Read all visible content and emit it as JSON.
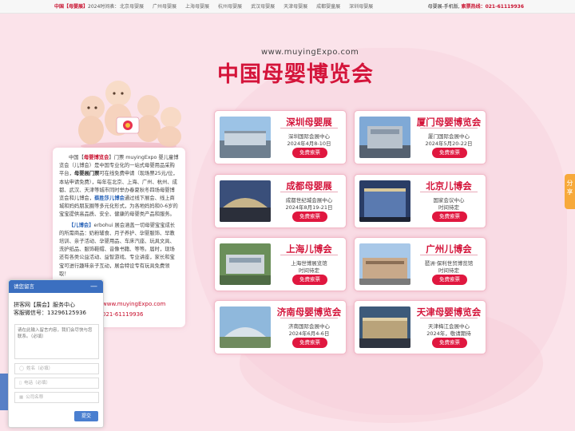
{
  "topbar": {
    "schedule_prefix": "中国【母婴展】",
    "schedule_suffix": "2024时间表：",
    "cities": [
      "北京母婴展",
      "广州母婴展",
      "上海母婴展",
      "杭州母婴展",
      "武汉母婴展",
      "天津母婴展",
      "成都婴童展",
      "深圳母婴展"
    ],
    "mobile": "母婴展-手机版,",
    "hotline_label": "索票热线：",
    "hotline": "021-61119936"
  },
  "header": {
    "www": "www.muyingExpo.com",
    "title": "中国母婴博览会"
  },
  "intro": {
    "p1_pre": "中国【",
    "p1_hl": "母婴博览会",
    "p1_mid": "】门票 muyingExpo 婴儿童博览会（儿博会）是中国专业化的一站式母婴用品采购平台，",
    "p1_b": "母婴展门票",
    "p1_post": "可在线免费申请（现场票25元/位，本站申请免费），每年在北京、上海、广州、杭州、成都、武汉、天津等城市同时举办春夏秋冬四场母婴博览会和儿博会，",
    "p1_hl2": "蔡胜莎儿博会",
    "p1_end": "通过线下展会、线上商城和妈妈朋友圈等多元化形式，为各地妈妈和0-6岁的宝宝提供高品质、安全、健康的母婴类产品和服务。",
    "p2_label": "【儿博会】",
    "p2_text": "erbohui 展会涵盖一切母婴宝宝成长的所需商品：奶粉辅食、月子养护、孕婴服饰、早教培训、亲子活动、孕婴用品、车床汽座、玩具文具、洗护纸品、服饰鞋帽、音像书籍、等等。届时，现场还有各类公益活动、益智游戏、专业讲座，家长和宝宝可进行趣味亲子互动，展会特设专有玩具免费领取！",
    "site": "www.muyingExpo.com",
    "phone": "021-61119936"
  },
  "cards": [
    {
      "name": "深圳母婴展",
      "venue": "深圳国际会展中心",
      "date": "2024年4月8-10日",
      "button": "免费索票"
    },
    {
      "name": "厦门母婴博览会",
      "venue": "厦门国际会展中心",
      "date": "2024年5月20-22日",
      "button": "免费索票"
    },
    {
      "name": "成都母婴展",
      "venue": "成都世纪城会展中心",
      "date": "2024年8月19-21日",
      "button": "免费索票"
    },
    {
      "name": "北京儿博会",
      "venue": "国家会议中心",
      "date": "时间待定",
      "button": "免费索票"
    },
    {
      "name": "上海儿博会",
      "venue": "上海世博展览馆",
      "date": "时间待定",
      "button": "免费索票"
    },
    {
      "name": "广州儿博会",
      "venue": "琶洲·保利世贸博览馆",
      "date": "时间待定",
      "button": "免费索票"
    },
    {
      "name": "济南母婴博览会",
      "venue": "济南国际会展中心",
      "date": "2024年6月4-6日",
      "button": "免费索票"
    },
    {
      "name": "天津母婴博览会",
      "venue": "天津梅江会展中心",
      "date": "2024年，敬请期待",
      "button": "免费索票"
    }
  ],
  "share": {
    "label": "分享"
  },
  "chat": {
    "title": "请您留言",
    "minimize": "—",
    "line1": "拼客网【展会】服务中心",
    "line2": "客服微信号：13296125936",
    "message_placeholder": "请在此输入留言内容，我们会尽快与您联系。（必填）",
    "name_placeholder": "姓名（必填）",
    "phone_placeholder": "电话（必填）",
    "company_placeholder": "公司名称",
    "submit": "提交"
  },
  "colors": {
    "accent": "#d4143a",
    "button": "#e0173f",
    "background": "#fbe3ea",
    "chat_blue": "#3b6fc0",
    "share_orange": "#f7a93b"
  }
}
